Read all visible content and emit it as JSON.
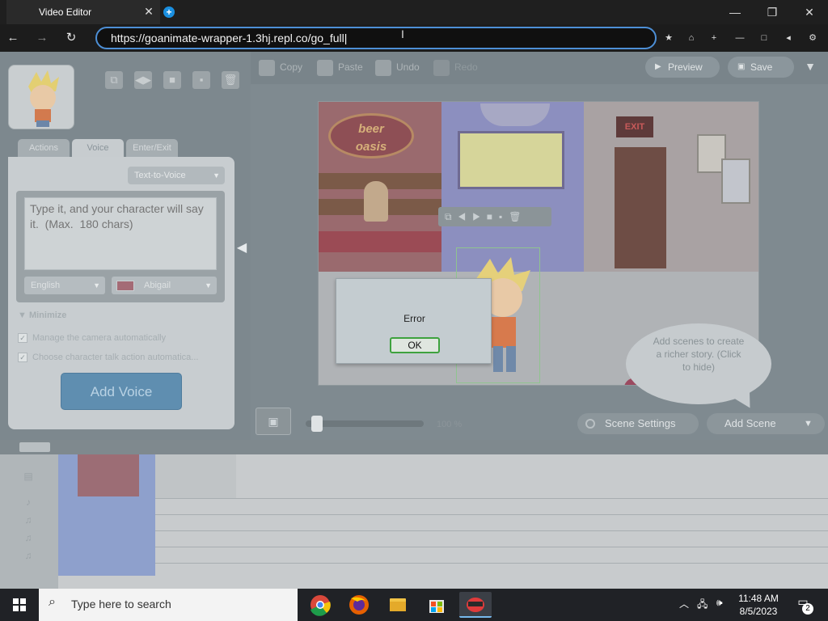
{
  "browser": {
    "tab_title": "Video Editor",
    "tab_close": "✕",
    "new_tab": "+",
    "url": "https://goanimate-wrapper-1.3hj.repl.co/go_full",
    "window_minimize": "—",
    "window_maximize": "❐",
    "window_close": "✕"
  },
  "toolbar": {
    "copy": "Copy",
    "paste": "Paste",
    "undo": "Undo",
    "redo": "Redo",
    "preview": "Preview",
    "save": "Save"
  },
  "left_panel": {
    "tabs": [
      "Actions",
      "Voice",
      "Enter/Exit"
    ],
    "active_tab": "Voice",
    "tts_mode": "Text-to-Voice",
    "text_placeholder": "Type it, and your character will say it.  (Max.  180 chars)",
    "language": "English",
    "voice": "Abigail",
    "minimize_label": "Minimize",
    "checkbox_camera": "Manage the camera automatically",
    "checkbox_talk": "Choose character talk action automatica...",
    "add_voice": "Add Voice"
  },
  "stage": {
    "sign_line1": "beer",
    "sign_line2": "oasis",
    "exit_sign": "EXIT",
    "bubble_text": "Add scenes to create a richer story. (Click to hide)"
  },
  "dialog": {
    "message": "Error",
    "ok": "OK"
  },
  "controls": {
    "zoom": "100 %",
    "scene_settings": "Scene Settings",
    "add_scene": "Add Scene"
  },
  "taskbar": {
    "search_placeholder": "Type here to search",
    "time": "11:48 AM",
    "date": "8/5/2023",
    "notification_count": "2"
  },
  "colors": {
    "accent": "#4d8fd6",
    "ok_border": "#3ea23e",
    "add_voice": "#5f8eb0"
  }
}
